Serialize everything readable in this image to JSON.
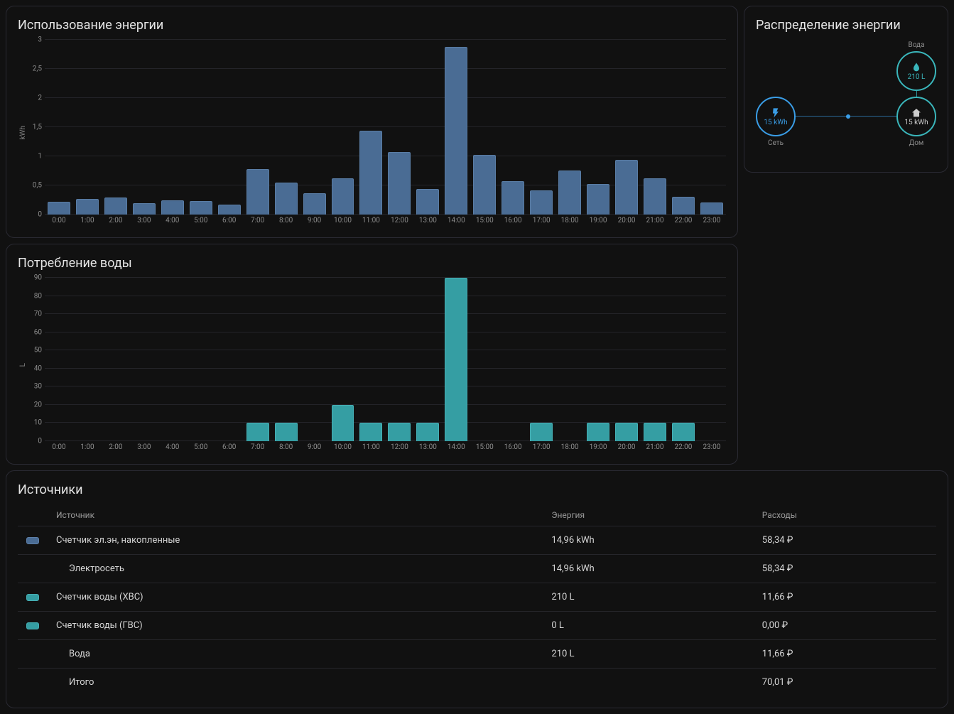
{
  "energy_card": {
    "title": "Использование энергии",
    "ylabel": "kWh"
  },
  "water_card": {
    "title": "Потребление воды",
    "ylabel": "L"
  },
  "sources_card": {
    "title": "Источники",
    "headers": {
      "source": "Источник",
      "energy": "Энергия",
      "cost": "Расходы"
    },
    "rows": [
      {
        "swatch": "e",
        "name": "Счетчик эл.эн, накопленные",
        "energy": "14,96 kWh",
        "cost": "58,34 ₽",
        "indent": false
      },
      {
        "swatch": "",
        "name": "Электросеть",
        "energy": "14,96 kWh",
        "cost": "58,34 ₽",
        "indent": true
      },
      {
        "swatch": "w",
        "name": "Счетчик воды (ХВС)",
        "energy": "210 L",
        "cost": "11,66 ₽",
        "indent": false
      },
      {
        "swatch": "w",
        "name": "Счетчик воды (ГВС)",
        "energy": "0 L",
        "cost": "0,00 ₽",
        "indent": false
      },
      {
        "swatch": "",
        "name": "Вода",
        "energy": "210 L",
        "cost": "11,66 ₽",
        "indent": true
      },
      {
        "swatch": "",
        "name": "Итого",
        "energy": "",
        "cost": "70,01 ₽",
        "indent": true
      }
    ]
  },
  "dist_card": {
    "title": "Распределение энергии",
    "grid": {
      "label": "Сеть",
      "value": "15 kWh"
    },
    "water": {
      "label": "Вода",
      "value": "210 L"
    },
    "home": {
      "label": "Дом",
      "value": "15 kWh"
    }
  },
  "chart_data": [
    {
      "type": "bar",
      "title": "Использование энергии",
      "ylabel": "kWh",
      "ylim": [
        0,
        3
      ],
      "yticks": [
        0,
        0.5,
        1,
        1.5,
        2,
        2.5,
        3
      ],
      "ytick_labels": [
        "0",
        "0,5",
        "1",
        "1,5",
        "2",
        "2,5",
        "3"
      ],
      "categories": [
        "0:00",
        "1:00",
        "2:00",
        "3:00",
        "4:00",
        "5:00",
        "6:00",
        "7:00",
        "8:00",
        "9:00",
        "10:00",
        "11:00",
        "12:00",
        "13:00",
        "14:00",
        "15:00",
        "16:00",
        "17:00",
        "18:00",
        "19:00",
        "20:00",
        "21:00",
        "22:00",
        "23:00"
      ],
      "values": [
        0.22,
        0.27,
        0.29,
        0.2,
        0.24,
        0.23,
        0.17,
        0.78,
        0.55,
        0.36,
        0.62,
        1.44,
        1.07,
        0.44,
        2.88,
        1.03,
        0.57,
        0.41,
        0.76,
        0.53,
        0.94,
        0.62,
        0.3,
        0.21
      ],
      "color": "#4a6c94"
    },
    {
      "type": "bar",
      "title": "Потребление воды",
      "ylabel": "L",
      "ylim": [
        0,
        90
      ],
      "yticks": [
        0,
        10,
        20,
        30,
        40,
        50,
        60,
        70,
        80,
        90
      ],
      "ytick_labels": [
        "0",
        "10",
        "20",
        "30",
        "40",
        "50",
        "60",
        "70",
        "80",
        "90"
      ],
      "categories": [
        "0:00",
        "1:00",
        "2:00",
        "3:00",
        "4:00",
        "5:00",
        "6:00",
        "7:00",
        "8:00",
        "9:00",
        "10:00",
        "11:00",
        "12:00",
        "13:00",
        "14:00",
        "15:00",
        "16:00",
        "17:00",
        "18:00",
        "19:00",
        "20:00",
        "21:00",
        "22:00",
        "23:00"
      ],
      "values": [
        0,
        0,
        0,
        0,
        0,
        0,
        0,
        10,
        10,
        0,
        20,
        10,
        10,
        10,
        90,
        0,
        0,
        10,
        0,
        10,
        10,
        10,
        10,
        0
      ],
      "color": "#359ea3"
    }
  ]
}
